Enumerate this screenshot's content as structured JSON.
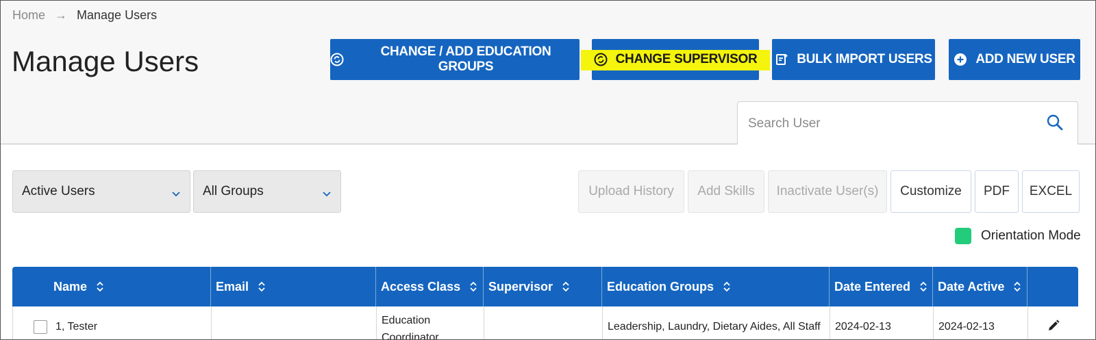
{
  "breadcrumb": {
    "home": "Home",
    "current": "Manage Users"
  },
  "page_title": "Manage Users",
  "header_buttons": {
    "education_groups": {
      "label": "CHANGE / ADD EDUCATION GROUPS",
      "icon": "refresh-circle-icon"
    },
    "supervisor": {
      "label": "CHANGE SUPERVISOR",
      "icon": "refresh-circle-icon"
    },
    "bulk_import": {
      "label": "BULK IMPORT USERS",
      "icon": "import-document-icon"
    },
    "add_user": {
      "label": "ADD NEW USER",
      "icon": "plus-circle-icon"
    }
  },
  "search": {
    "placeholder": "Search User",
    "value": ""
  },
  "filters": {
    "status": "Active Users",
    "group": "All Groups"
  },
  "toolbar": {
    "upload_history": "Upload History",
    "add_skills": "Add Skills",
    "inactivate": "Inactivate User(s)",
    "customize": "Customize",
    "pdf": "PDF",
    "excel": "EXCEL"
  },
  "legend": {
    "label": "Orientation Mode",
    "color": "#22cc7a"
  },
  "colors": {
    "primary": "#1565c0",
    "highlight": "#f4f40c"
  },
  "table": {
    "columns": [
      "Name",
      "Email",
      "Access Class",
      "Supervisor",
      "Education Groups",
      "Date Entered",
      "Date Active"
    ],
    "rows": [
      {
        "name": "1, Tester",
        "email": "",
        "access_class_line1": "Education",
        "access_class_line2": "Coordinator",
        "supervisor": "",
        "education_groups": "Leadership, Laundry, Dietary Aides, All Staff",
        "date_entered": "2024-02-13",
        "date_active": "2024-02-13"
      }
    ]
  }
}
